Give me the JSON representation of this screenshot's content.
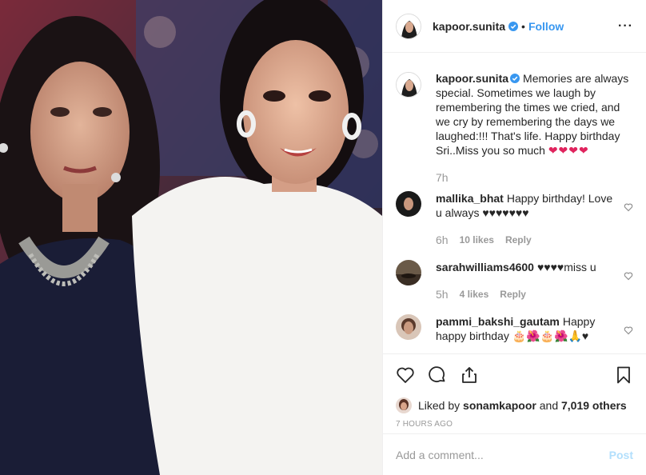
{
  "header": {
    "username": "kapoor.sunita",
    "separator": "•",
    "follow_label": "Follow",
    "more_label": "···"
  },
  "caption": {
    "username": "kapoor.sunita",
    "text": "Memories are always special. Sometimes we laugh by remembering the times we cried, and we cry by remembering the days we laughed:!!! That's life. Happy birthday Sri..Miss you so much",
    "hearts": "❤❤❤❤",
    "time": "7h"
  },
  "comments": [
    {
      "username": "mallika_bhat",
      "text": "Happy birthday! Love u always ♥♥♥♥♥♥♥",
      "time": "6h",
      "likes": "10 likes",
      "reply": "Reply"
    },
    {
      "username": "sarahwilliams4600",
      "text": "♥♥♥♥miss u",
      "time": "5h",
      "likes": "4 likes",
      "reply": "Reply"
    },
    {
      "username": "pammi_bakshi_gautam",
      "text": "Happy happy birthday 🎂🌺🎂🌺🙏♥",
      "time": "",
      "likes": "",
      "reply": ""
    }
  ],
  "likes": {
    "prefix": "Liked by",
    "user": "sonamkapoor",
    "conj": "and",
    "count": "7,019 others"
  },
  "posted_time": "7 HOURS AGO",
  "add_comment": {
    "placeholder": "Add a comment...",
    "post_label": "Post"
  },
  "colors": {
    "accent": "#3897f0",
    "text": "#262626",
    "muted": "#999999",
    "heart_red": "#e0245e",
    "post_disabled": "#b2dffc"
  },
  "icons": {
    "verified": "verified-badge-icon",
    "like": "heart-outline-icon",
    "comment": "comment-bubble-icon",
    "share": "share-icon",
    "save": "bookmark-icon"
  }
}
